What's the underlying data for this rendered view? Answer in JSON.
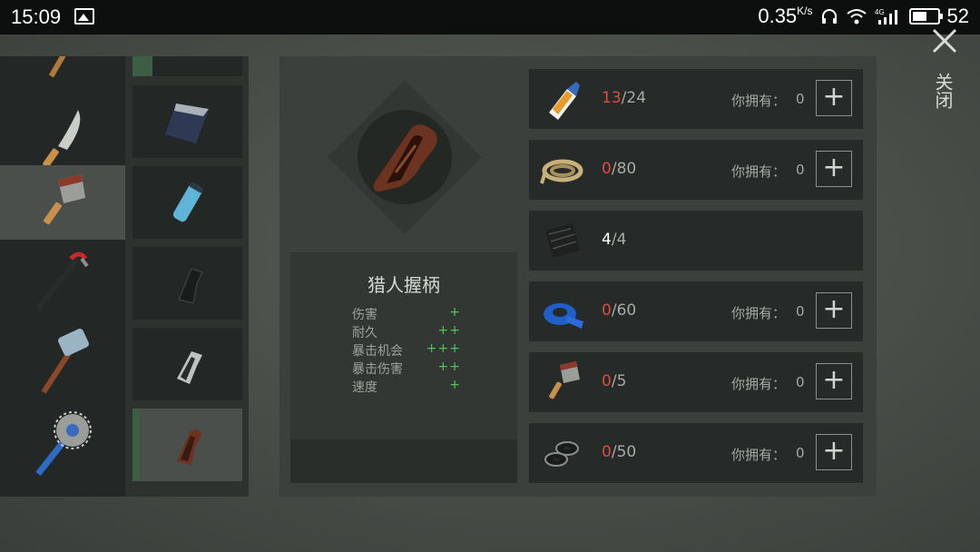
{
  "status_bar": {
    "time": "15:09",
    "speed": "0.35",
    "speed_unit": "K/s",
    "battery": "52"
  },
  "close": {
    "label": "关闭"
  },
  "categories": [
    {
      "icon": "axe-icon"
    },
    {
      "icon": "machete-icon"
    },
    {
      "icon": "cleaver-icon",
      "selected": true
    },
    {
      "icon": "crowbar-icon"
    },
    {
      "icon": "sledgehammer-icon"
    },
    {
      "icon": "saw-mace-icon"
    }
  ],
  "parts": [
    {
      "icon": "blade-part-icon"
    },
    {
      "icon": "scrap-blade-icon"
    },
    {
      "icon": "tape-wrap-icon"
    },
    {
      "icon": "black-grip-icon"
    },
    {
      "icon": "steel-grip-icon"
    },
    {
      "icon": "hunter-grip-icon",
      "selected": true
    }
  ],
  "item": {
    "name": "猎人握柄",
    "stats": [
      {
        "label": "伤害",
        "value": "+"
      },
      {
        "label": "耐久",
        "value": "++"
      },
      {
        "label": "暴击机会",
        "value": "+++"
      },
      {
        "label": "暴击伤害",
        "value": "++"
      },
      {
        "label": "速度",
        "value": "+"
      }
    ]
  },
  "materials": [
    {
      "icon": "glue-icon",
      "current": "13",
      "required": "24",
      "own_label": "你拥有：",
      "own": "0",
      "enough": false
    },
    {
      "icon": "rope-icon",
      "current": "0",
      "required": "80",
      "own_label": "你拥有：",
      "own": "0",
      "enough": false
    },
    {
      "icon": "rubber-sheet-icon",
      "current": "4",
      "required": "4",
      "enough": true
    },
    {
      "icon": "duct-tape-icon",
      "current": "0",
      "required": "60",
      "own_label": "你拥有：",
      "own": "0",
      "enough": false
    },
    {
      "icon": "cleaver-icon",
      "current": "0",
      "required": "5",
      "own_label": "你拥有：",
      "own": "0",
      "enough": false
    },
    {
      "icon": "washers-icon",
      "current": "0",
      "required": "50",
      "own_label": "你拥有：",
      "own": "0",
      "enough": false
    }
  ],
  "colors": {
    "insufficient": "#e04b3c",
    "stat_plus": "#53c45a",
    "selected_accent": "#3c5e45"
  }
}
